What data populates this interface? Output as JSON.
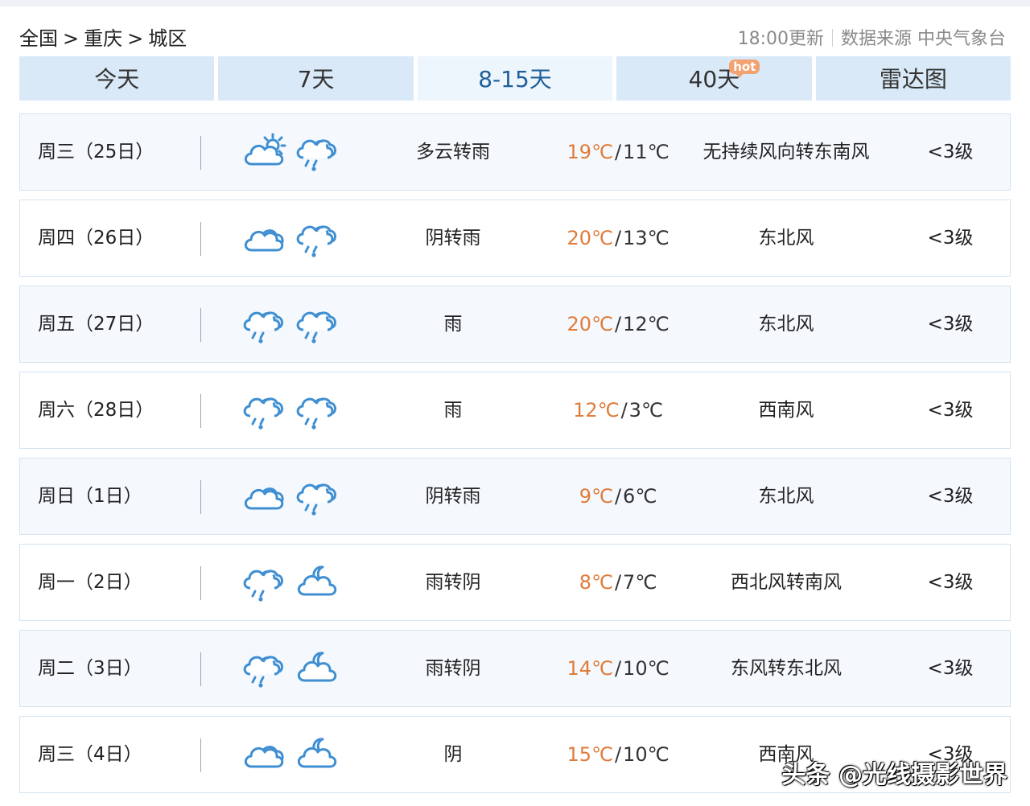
{
  "breadcrumb": [
    "全国",
    "重庆",
    "城区"
  ],
  "breadcrumb_sep": ">",
  "meta": {
    "update": "18:00更新",
    "source": "数据来源 中央气象台"
  },
  "tabs": [
    {
      "label": "今天"
    },
    {
      "label": "7天"
    },
    {
      "label": "8-15天",
      "active": true
    },
    {
      "label": "40天",
      "badge": "hot"
    },
    {
      "label": "雷达图"
    }
  ],
  "days": [
    {
      "date": "周三（25日）",
      "icons": [
        "partly-cloudy-day-icon",
        "rain-icon"
      ],
      "weather": "多云转雨",
      "hi": "19℃",
      "lo": "11℃",
      "wind": "无持续风向转东南风",
      "level": "<3级"
    },
    {
      "date": "周四（26日）",
      "icons": [
        "cloudy-icon",
        "rain-icon"
      ],
      "weather": "阴转雨",
      "hi": "20℃",
      "lo": "13℃",
      "wind": "东北风",
      "level": "<3级"
    },
    {
      "date": "周五（27日）",
      "icons": [
        "rain-icon",
        "rain-icon"
      ],
      "weather": "雨",
      "hi": "20℃",
      "lo": "12℃",
      "wind": "东北风",
      "level": "<3级"
    },
    {
      "date": "周六（28日）",
      "icons": [
        "rain-icon",
        "rain-icon"
      ],
      "weather": "雨",
      "hi": "12℃",
      "lo": "3℃",
      "wind": "西南风",
      "level": "<3级"
    },
    {
      "date": "周日（1日）",
      "icons": [
        "cloudy-icon",
        "rain-icon"
      ],
      "weather": "阴转雨",
      "hi": "9℃",
      "lo": "6℃",
      "wind": "东北风",
      "level": "<3级"
    },
    {
      "date": "周一（2日）",
      "icons": [
        "rain-icon",
        "cloudy-night-icon"
      ],
      "weather": "雨转阴",
      "hi": "8℃",
      "lo": "7℃",
      "wind": "西北风转南风",
      "level": "<3级"
    },
    {
      "date": "周二（3日）",
      "icons": [
        "rain-icon",
        "cloudy-night-icon"
      ],
      "weather": "雨转阴",
      "hi": "14℃",
      "lo": "10℃",
      "wind": "东风转东北风",
      "level": "<3级"
    },
    {
      "date": "周三（4日）",
      "icons": [
        "cloudy-icon",
        "cloudy-night-icon"
      ],
      "weather": "阴",
      "hi": "15℃",
      "lo": "10℃",
      "wind": "西南风",
      "level": "<3级"
    }
  ],
  "watermark": "头条 @光线摄影世界",
  "colors": {
    "tab_bg": "#d9e9f7",
    "tab_active_bg": "#eef6fd",
    "tab_active_text": "#1f5f99",
    "high_temp": "#e07b3a",
    "row_border": "#d6e4f0",
    "icon_stroke": "#3f8fd2",
    "hot_badge": "#f2a16f"
  }
}
